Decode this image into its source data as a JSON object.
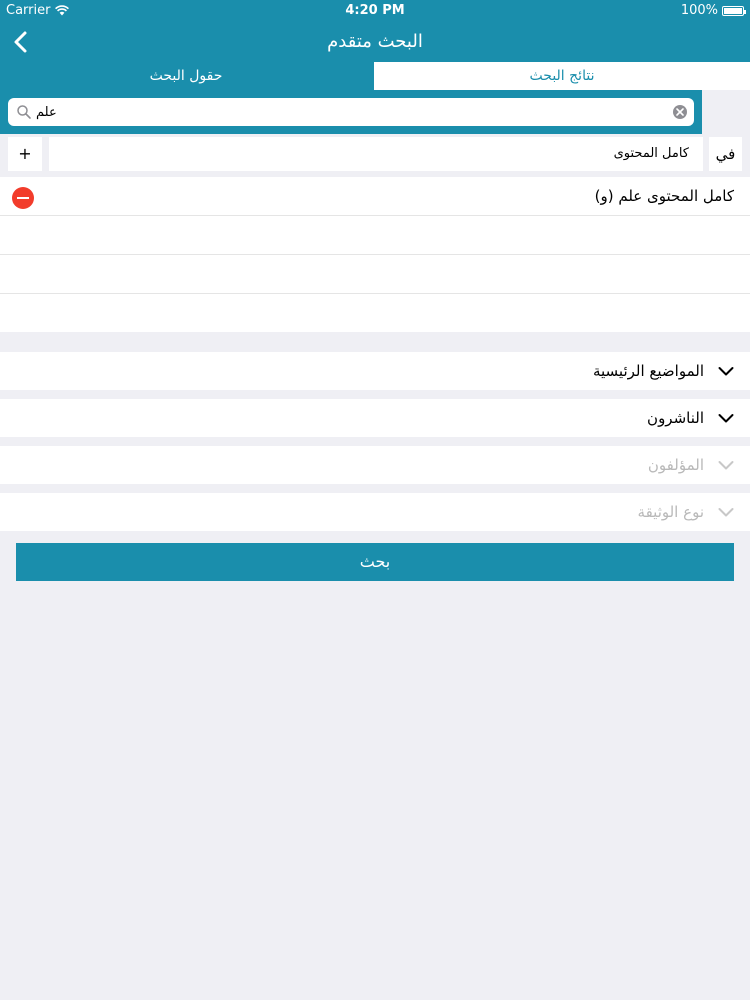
{
  "status_bar": {
    "carrier": "Carrier",
    "time": "4:20 PM",
    "battery": "100%"
  },
  "nav": {
    "title": "البحث متقدم"
  },
  "tabs": {
    "fields": "حقول البحث",
    "results": "نتائج البحث"
  },
  "search": {
    "value": "علم"
  },
  "field_row": {
    "add_label": "+",
    "selected_field": "كامل المحتوى",
    "in_label": "في"
  },
  "criteria": [
    {
      "text": "(و) كامل المحتوى علم"
    }
  ],
  "filters": [
    {
      "label": "المواضيع الرئيسية",
      "enabled": true
    },
    {
      "label": "الناشرون",
      "enabled": true
    },
    {
      "label": "المؤلفون",
      "enabled": false
    },
    {
      "label": "نوع الوثيقة",
      "enabled": false
    }
  ],
  "actions": {
    "search_label": "بحث"
  },
  "colors": {
    "brand": "#1a8eac",
    "background": "#efeff4",
    "remove": "#f23c2b",
    "disabled": "#b9b9b9"
  }
}
